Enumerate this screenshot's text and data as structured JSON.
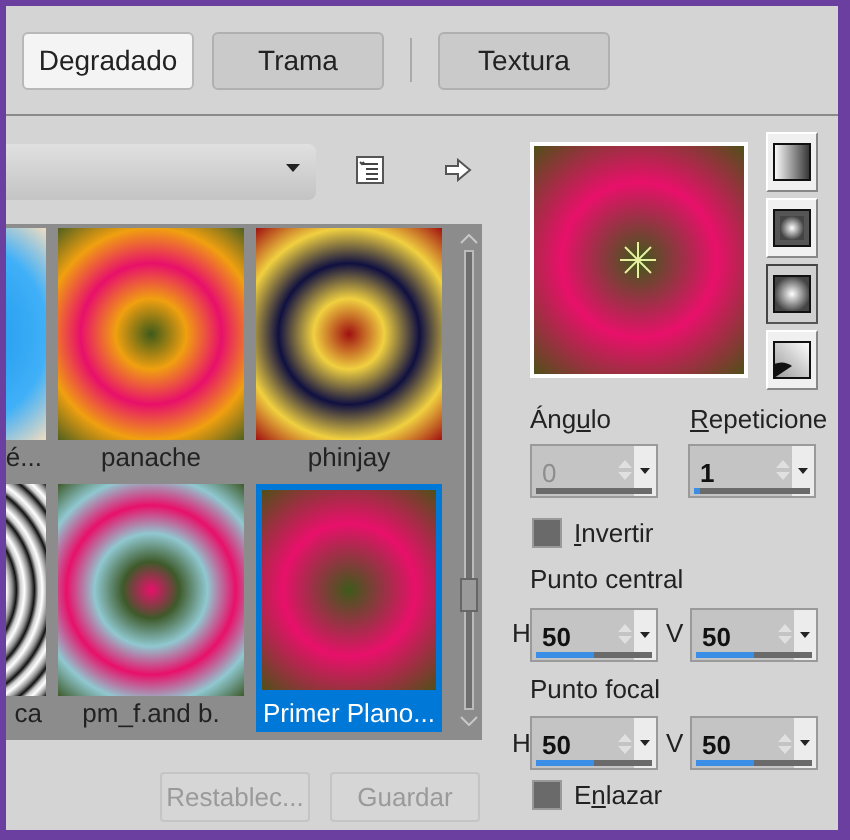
{
  "tabs": [
    {
      "label": "Degradado",
      "selected": true
    },
    {
      "label": "Trama",
      "selected": false
    },
    {
      "label": "Textura",
      "selected": false
    }
  ],
  "gradients": [
    {
      "label": "é...",
      "selected": false
    },
    {
      "label": "panache",
      "selected": false
    },
    {
      "label": "phinjay",
      "selected": false
    },
    {
      "label": "ca",
      "selected": false
    },
    {
      "label": "pm_f.and b.",
      "selected": false
    },
    {
      "label": "Primer Plano...",
      "selected": true
    }
  ],
  "buttons": [
    {
      "label": "Restablec...",
      "disabled": true
    },
    {
      "label": "Guardar",
      "disabled": true
    }
  ],
  "gradient_types": [
    {
      "kind": "linear",
      "selected": false
    },
    {
      "kind": "rectangular",
      "selected": false
    },
    {
      "kind": "radial",
      "selected": true
    },
    {
      "kind": "corner",
      "selected": false
    }
  ],
  "angle": {
    "label": {
      "before": "Áng",
      "key": "u",
      "after": "lo"
    },
    "value": "0",
    "disabled": true
  },
  "repeats": {
    "label": {
      "key": "R",
      "after": "epeticione"
    },
    "value": "1",
    "level": 0.05
  },
  "invert": {
    "label": {
      "key": "I",
      "after": "nvertir"
    },
    "checked": false
  },
  "center": {
    "title": "Punto central",
    "h": {
      "label": "H",
      "value": "50",
      "level": 0.5
    },
    "v": {
      "label": "V",
      "value": "50",
      "level": 0.5
    }
  },
  "focal": {
    "title": "Punto focal",
    "h": {
      "label": "H",
      "value": "50",
      "level": 0.5
    },
    "v": {
      "label": "V",
      "value": "50",
      "level": 0.5
    }
  },
  "link": {
    "label": {
      "before": "E",
      "key": "n",
      "after": "lazar"
    },
    "checked": false
  }
}
